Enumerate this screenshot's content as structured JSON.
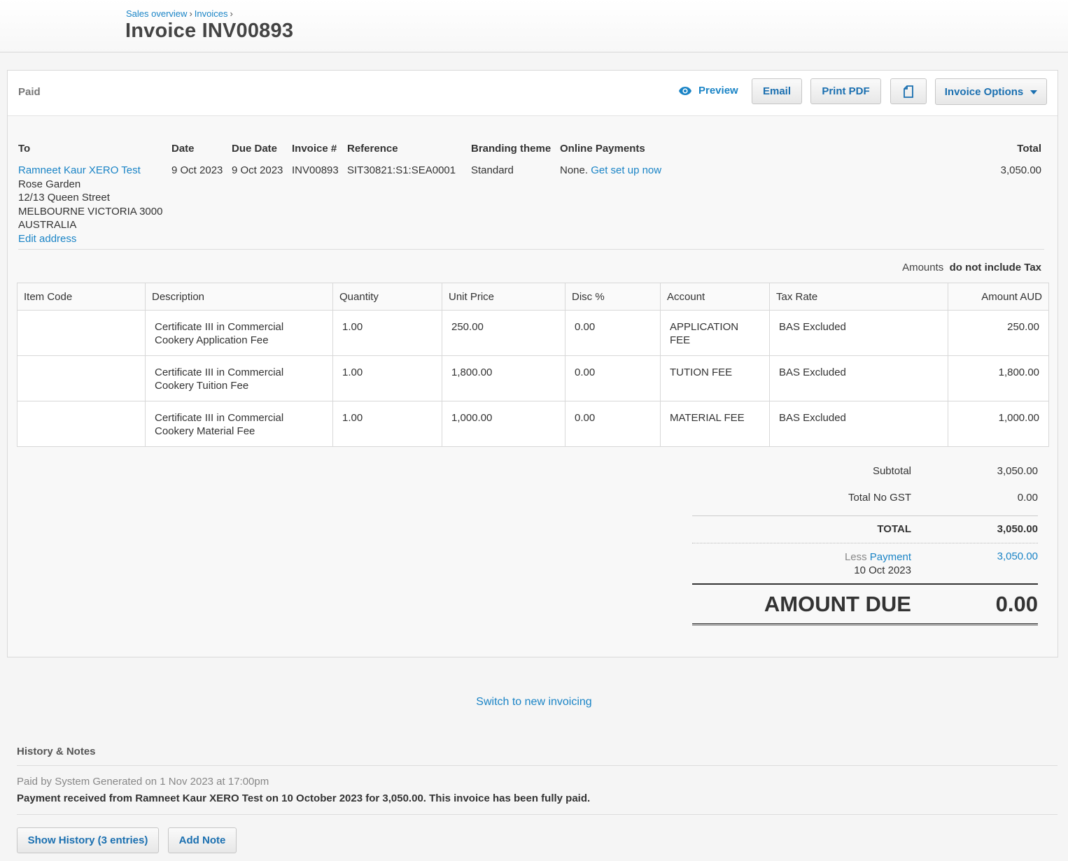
{
  "breadcrumb": {
    "item1": "Sales overview",
    "item2": "Invoices",
    "sep": "›"
  },
  "page_title": "Invoice INV00893",
  "toolbar": {
    "status": "Paid",
    "preview": "Preview",
    "email": "Email",
    "print_pdf": "Print PDF",
    "invoice_options": "Invoice Options",
    "icons": {
      "preview": "eye-icon",
      "copy": "copy-document-icon",
      "options": "chevron-down-icon"
    }
  },
  "info": {
    "to": {
      "header": "To",
      "contact": "Ramneet Kaur XERO Test",
      "address": [
        "Rose Garden",
        "12/13 Queen Street",
        "MELBOURNE VICTORIA 3000",
        "AUSTRALIA"
      ],
      "edit_link": "Edit address"
    },
    "date": {
      "header": "Date",
      "value": "9 Oct 2023"
    },
    "due_date": {
      "header": "Due Date",
      "value": "9 Oct 2023"
    },
    "invoice_number": {
      "header": "Invoice #",
      "value": "INV00893"
    },
    "reference": {
      "header": "Reference",
      "value": "SIT30821:S1:SEA0001"
    },
    "branding": {
      "header": "Branding theme",
      "value": "Standard"
    },
    "online_payments": {
      "header": "Online Payments",
      "value": "None.",
      "link": "Get set up now"
    },
    "total": {
      "header": "Total",
      "value": "3,050.00"
    }
  },
  "amounts_note": {
    "prefix": "Amounts",
    "value": "do not include Tax"
  },
  "table": {
    "headers": [
      "Item Code",
      "Description",
      "Quantity",
      "Unit Price",
      "Disc %",
      "Account",
      "Tax Rate",
      "Amount AUD"
    ],
    "rows": [
      {
        "item_code": "",
        "description": [
          "Certificate III in Commercial",
          "Cookery Application Fee"
        ],
        "quantity": "1.00",
        "unit_price": "250.00",
        "disc": "0.00",
        "account": [
          "APPLICATION",
          "FEE"
        ],
        "tax_rate": "BAS Excluded",
        "amount": "250.00"
      },
      {
        "item_code": "",
        "description": [
          "Certificate III in Commercial",
          "Cookery Tuition Fee"
        ],
        "quantity": "1.00",
        "unit_price": "1,800.00",
        "disc": "0.00",
        "account": [
          "TUTION FEE"
        ],
        "tax_rate": "BAS Excluded",
        "amount": "1,800.00"
      },
      {
        "item_code": "",
        "description": [
          "Certificate III in Commercial",
          "Cookery Material Fee"
        ],
        "quantity": "1.00",
        "unit_price": "1,000.00",
        "disc": "0.00",
        "account": [
          "MATERIAL FEE"
        ],
        "tax_rate": "BAS Excluded",
        "amount": "1,000.00"
      }
    ]
  },
  "totals": {
    "subtotal_label": "Subtotal",
    "subtotal": "3,050.00",
    "no_gst_label": "Total No GST",
    "no_gst": "0.00",
    "total_label": "TOTAL",
    "total": "3,050.00",
    "less": "Less",
    "payment_label": "Payment",
    "payment_date": "10 Oct 2023",
    "payment": "3,050.00",
    "amount_due_label": "AMOUNT DUE",
    "amount_due": "0.00"
  },
  "switch_link": "Switch to new invoicing",
  "history": {
    "title": "History & Notes",
    "meta": "Paid by System Generated on 1 Nov 2023 at 17:00pm",
    "text": "Payment received from Ramneet Kaur XERO Test on 10 October 2023 for 3,050.00. This invoice has been fully paid.",
    "show_history": "Show History (3 entries)",
    "add_note": "Add Note"
  },
  "colors": {
    "link": "#1a84c6",
    "button_text": "#1a6fb0",
    "background": "#f5f5f5"
  }
}
